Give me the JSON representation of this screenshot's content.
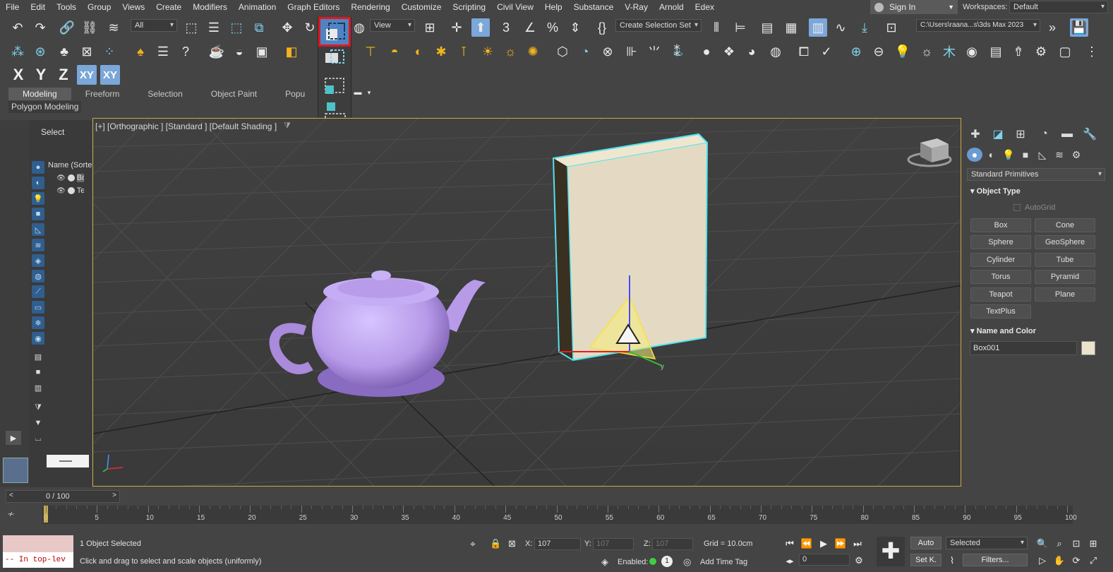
{
  "menu": [
    "File",
    "Edit",
    "Tools",
    "Group",
    "Views",
    "Create",
    "Modifiers",
    "Animation",
    "Graph Editors",
    "Rendering",
    "Customize",
    "Scripting",
    "Civil View",
    "Help",
    "Substance",
    "V-Ray",
    "Arnold",
    "Edex"
  ],
  "signin_label": "Sign In",
  "workspaces_label": "Workspaces:",
  "workspace_value": "Default",
  "toolbar": {
    "filter_value": "All",
    "refcoord_value": "View",
    "selection_set": "Create Selection Set",
    "path_value": "C:\\Users\\raana...s\\3ds Max 2023"
  },
  "axis_buttons": [
    "X",
    "Y",
    "Z",
    "XY",
    "XY"
  ],
  "ribbon_tabs": [
    "Modeling",
    "Freeform",
    "Selection",
    "Object Paint",
    "Popu"
  ],
  "ribbon_sub": "Polygon Modeling",
  "explorer": {
    "title": "Select",
    "column": "Name (Sorte",
    "rows": [
      "Bo",
      "Te"
    ]
  },
  "viewport_label": "[+] [Orthographic ] [Standard ] [Default Shading ]",
  "gizmo_labels": {
    "z": "z",
    "y": "y"
  },
  "command_panel": {
    "category": "Standard Primitives",
    "object_type_title": "Object Type",
    "autogrid_label": "AutoGrid",
    "primitives": [
      "Box",
      "Cone",
      "Sphere",
      "GeoSphere",
      "Cylinder",
      "Tube",
      "Torus",
      "Pyramid",
      "Teapot",
      "Plane",
      "TextPlus"
    ],
    "name_color_title": "Name and Color",
    "object_name": "Box001",
    "object_color": "#ece3cc"
  },
  "timeline": {
    "frame_display": "0 / 100",
    "ticks": [
      "0",
      "5",
      "10",
      "15",
      "20",
      "25",
      "30",
      "35",
      "40",
      "45",
      "50",
      "55",
      "60",
      "65",
      "70",
      "75",
      "80",
      "85",
      "90",
      "95",
      "100"
    ]
  },
  "status": {
    "maxscript_line": "-- In top-lev",
    "selected_count": "1 Object Selected",
    "prompt": "Click and drag to select and scale objects (uniformly)",
    "x_label": "X:",
    "x_value": "107",
    "y_label": "Y:",
    "y_value": "107",
    "z_label": "Z:",
    "z_value": "107",
    "grid": "Grid = 10.0cm",
    "enabled_label": "Enabled:",
    "enabled_count": "1",
    "add_time_tag": "Add Time Tag",
    "auto_label": "Auto",
    "setkey_label": "Set K.",
    "selected_dropdown": "Selected",
    "filters_label": "Filters...",
    "frame_value": "0"
  },
  "colors": {
    "teapot": "#b79ae8",
    "box": "#e4dac3",
    "selection_highlight": "#e01820",
    "active_button": "#7ba7d9"
  }
}
